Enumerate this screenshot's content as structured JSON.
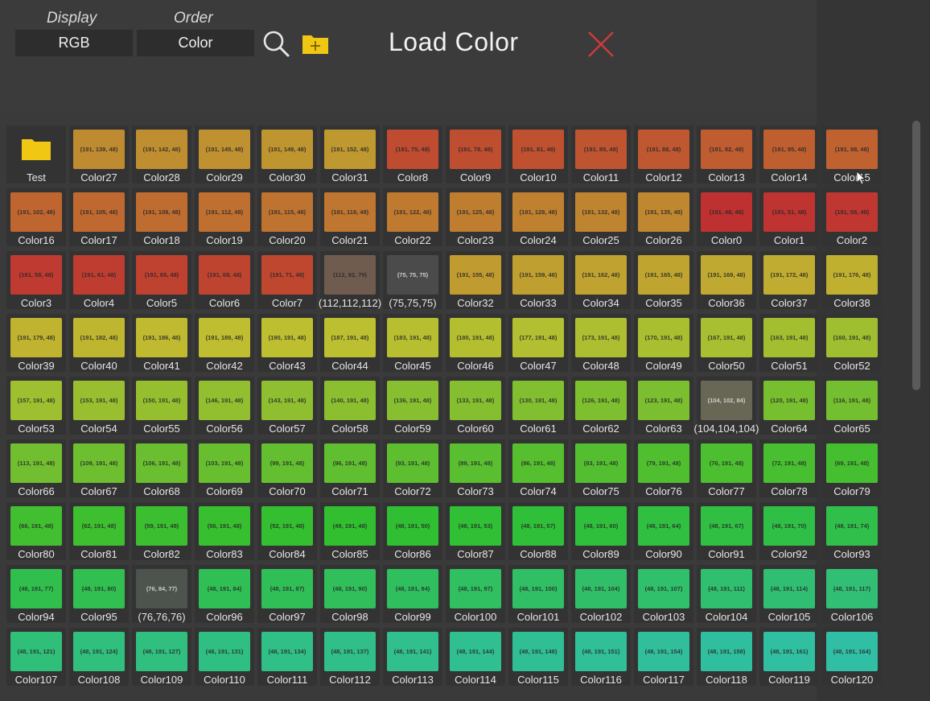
{
  "toolbar": {
    "display_label": "Display",
    "display_value": "RGB",
    "order_label": "Order",
    "order_value": "Color",
    "title": "Load Color",
    "search_icon": "search-icon",
    "new_folder_icon": "folder-add-icon",
    "close_icon": "close-icon",
    "accent_folder": "#f0c814",
    "close_color": "#d03a3a"
  },
  "items": [
    {
      "label": "Test",
      "folder": true
    },
    {
      "label": "Color27",
      "rgb": "(191, 139, 48)",
      "color": "#bf8b30"
    },
    {
      "label": "Color28",
      "rgb": "(191, 142, 48)",
      "color": "#bf8e30"
    },
    {
      "label": "Color29",
      "rgb": "(191, 145, 48)",
      "color": "#bf9130"
    },
    {
      "label": "Color30",
      "rgb": "(191, 149, 48)",
      "color": "#bf9530"
    },
    {
      "label": "Color31",
      "rgb": "(191, 152, 48)",
      "color": "#bf9830"
    },
    {
      "label": "Color8",
      "rgb": "(191, 75, 48)",
      "color": "#bf4b30"
    },
    {
      "label": "Color9",
      "rgb": "(191, 78, 48)",
      "color": "#bf4e30"
    },
    {
      "label": "Color10",
      "rgb": "(191, 81, 48)",
      "color": "#bf5130"
    },
    {
      "label": "Color11",
      "rgb": "(191, 85, 48)",
      "color": "#bf5530"
    },
    {
      "label": "Color12",
      "rgb": "(191, 88, 48)",
      "color": "#bf5830"
    },
    {
      "label": "Color13",
      "rgb": "(191, 92, 48)",
      "color": "#bf5c30"
    },
    {
      "label": "Color14",
      "rgb": "(191, 95, 48)",
      "color": "#bf5f30"
    },
    {
      "label": "Color15",
      "rgb": "(191, 98, 48)",
      "color": "#bf6230"
    },
    {
      "label": "Color16",
      "rgb": "(191, 102, 48)",
      "color": "#bf6630"
    },
    {
      "label": "Color17",
      "rgb": "(191, 105, 48)",
      "color": "#bf6930"
    },
    {
      "label": "Color18",
      "rgb": "(191, 108, 48)",
      "color": "#bf6c30"
    },
    {
      "label": "Color19",
      "rgb": "(191, 112, 48)",
      "color": "#bf7030"
    },
    {
      "label": "Color20",
      "rgb": "(191, 115, 48)",
      "color": "#bf7330"
    },
    {
      "label": "Color21",
      "rgb": "(191, 118, 48)",
      "color": "#bf7630"
    },
    {
      "label": "Color22",
      "rgb": "(191, 122, 48)",
      "color": "#bf7a30"
    },
    {
      "label": "Color23",
      "rgb": "(191, 125, 48)",
      "color": "#bf7d30"
    },
    {
      "label": "Color24",
      "rgb": "(191, 128, 48)",
      "color": "#bf8030"
    },
    {
      "label": "Color25",
      "rgb": "(191, 132, 48)",
      "color": "#bf8430"
    },
    {
      "label": "Color26",
      "rgb": "(191, 135, 48)",
      "color": "#bf8730"
    },
    {
      "label": "Color0",
      "rgb": "(191, 48, 48)",
      "color": "#bf3030"
    },
    {
      "label": "Color1",
      "rgb": "(191, 51, 48)",
      "color": "#bf3330"
    },
    {
      "label": "Color2",
      "rgb": "(191, 55, 48)",
      "color": "#bf3730"
    },
    {
      "label": "Color3",
      "rgb": "(191, 58, 48)",
      "color": "#bf3a30"
    },
    {
      "label": "Color4",
      "rgb": "(191, 61, 48)",
      "color": "#bf3d30"
    },
    {
      "label": "Color5",
      "rgb": "(191, 65, 48)",
      "color": "#bf4130"
    },
    {
      "label": "Color6",
      "rgb": "(191, 68, 48)",
      "color": "#bf4430"
    },
    {
      "label": "Color7",
      "rgb": "(191, 71, 48)",
      "color": "#bf4730"
    },
    {
      "label": "(112,112,112)",
      "rgb": "(112, 92, 79)",
      "color": "#705c4f"
    },
    {
      "label": "(75,75,75)",
      "rgb": "(75, 75, 75)",
      "color": "#4b4b4b",
      "light_text": true
    },
    {
      "label": "Color32",
      "rgb": "(191, 155, 48)",
      "color": "#bf9b30"
    },
    {
      "label": "Color33",
      "rgb": "(191, 159, 48)",
      "color": "#bf9f30"
    },
    {
      "label": "Color34",
      "rgb": "(191, 162, 48)",
      "color": "#bfa230"
    },
    {
      "label": "Color35",
      "rgb": "(191, 165, 48)",
      "color": "#bfa530"
    },
    {
      "label": "Color36",
      "rgb": "(191, 169, 48)",
      "color": "#bfa930"
    },
    {
      "label": "Color37",
      "rgb": "(191, 172, 48)",
      "color": "#bfac30"
    },
    {
      "label": "Color38",
      "rgb": "(191, 176, 48)",
      "color": "#bfb030"
    },
    {
      "label": "Color39",
      "rgb": "(191, 179, 48)",
      "color": "#bfb330"
    },
    {
      "label": "Color40",
      "rgb": "(191, 182, 48)",
      "color": "#bfb630"
    },
    {
      "label": "Color41",
      "rgb": "(191, 186, 48)",
      "color": "#bfba30"
    },
    {
      "label": "Color42",
      "rgb": "(191, 189, 48)",
      "color": "#bfbd30"
    },
    {
      "label": "Color43",
      "rgb": "(190, 191, 48)",
      "color": "#bebf30"
    },
    {
      "label": "Color44",
      "rgb": "(187, 191, 48)",
      "color": "#bbbf30"
    },
    {
      "label": "Color45",
      "rgb": "(183, 191, 48)",
      "color": "#b7bf30"
    },
    {
      "label": "Color46",
      "rgb": "(180, 191, 48)",
      "color": "#b4bf30"
    },
    {
      "label": "Color47",
      "rgb": "(177, 191, 48)",
      "color": "#b1bf30"
    },
    {
      "label": "Color48",
      "rgb": "(173, 191, 48)",
      "color": "#adbf30"
    },
    {
      "label": "Color49",
      "rgb": "(170, 191, 48)",
      "color": "#aabf30"
    },
    {
      "label": "Color50",
      "rgb": "(167, 191, 48)",
      "color": "#a7bf30"
    },
    {
      "label": "Color51",
      "rgb": "(163, 191, 48)",
      "color": "#a3bf30"
    },
    {
      "label": "Color52",
      "rgb": "(160, 191, 48)",
      "color": "#a0bf30"
    },
    {
      "label": "Color53",
      "rgb": "(157, 191, 48)",
      "color": "#9dbf30"
    },
    {
      "label": "Color54",
      "rgb": "(153, 191, 48)",
      "color": "#99bf30"
    },
    {
      "label": "Color55",
      "rgb": "(150, 191, 48)",
      "color": "#96bf30"
    },
    {
      "label": "Color56",
      "rgb": "(146, 191, 48)",
      "color": "#92bf30"
    },
    {
      "label": "Color57",
      "rgb": "(143, 191, 48)",
      "color": "#8fbf30"
    },
    {
      "label": "Color58",
      "rgb": "(140, 191, 48)",
      "color": "#8cbf30"
    },
    {
      "label": "Color59",
      "rgb": "(136, 191, 48)",
      "color": "#88bf30"
    },
    {
      "label": "Color60",
      "rgb": "(133, 191, 48)",
      "color": "#85bf30"
    },
    {
      "label": "Color61",
      "rgb": "(130, 191, 48)",
      "color": "#82bf30"
    },
    {
      "label": "Color62",
      "rgb": "(126, 191, 48)",
      "color": "#7ebf30"
    },
    {
      "label": "Color63",
      "rgb": "(123, 191, 48)",
      "color": "#7bbf30"
    },
    {
      "label": "(104,104,104)",
      "rgb": "(104, 102, 84)",
      "color": "#686654",
      "light_text": true
    },
    {
      "label": "Color64",
      "rgb": "(120, 191, 48)",
      "color": "#78bf30"
    },
    {
      "label": "Color65",
      "rgb": "(116, 191, 48)",
      "color": "#74bf30"
    },
    {
      "label": "Color66",
      "rgb": "(113, 191, 48)",
      "color": "#71bf30"
    },
    {
      "label": "Color67",
      "rgb": "(109, 191, 48)",
      "color": "#6dbf30"
    },
    {
      "label": "Color68",
      "rgb": "(106, 191, 48)",
      "color": "#6abf30"
    },
    {
      "label": "Color69",
      "rgb": "(103, 191, 48)",
      "color": "#67bf30"
    },
    {
      "label": "Color70",
      "rgb": "(99, 191, 48)",
      "color": "#63bf30"
    },
    {
      "label": "Color71",
      "rgb": "(96, 191, 48)",
      "color": "#60bf30"
    },
    {
      "label": "Color72",
      "rgb": "(93, 191, 48)",
      "color": "#5dbf30"
    },
    {
      "label": "Color73",
      "rgb": "(89, 191, 48)",
      "color": "#59bf30"
    },
    {
      "label": "Color74",
      "rgb": "(86, 191, 48)",
      "color": "#56bf30"
    },
    {
      "label": "Color75",
      "rgb": "(83, 191, 48)",
      "color": "#53bf30"
    },
    {
      "label": "Color76",
      "rgb": "(79, 191, 48)",
      "color": "#4fbf30"
    },
    {
      "label": "Color77",
      "rgb": "(76, 191, 48)",
      "color": "#4cbf30"
    },
    {
      "label": "Color78",
      "rgb": "(72, 191, 48)",
      "color": "#48bf30"
    },
    {
      "label": "Color79",
      "rgb": "(69, 191, 48)",
      "color": "#45bf30"
    },
    {
      "label": "Color80",
      "rgb": "(66, 191, 48)",
      "color": "#42bf30"
    },
    {
      "label": "Color81",
      "rgb": "(62, 191, 48)",
      "color": "#3ebf30"
    },
    {
      "label": "Color82",
      "rgb": "(59, 191, 48)",
      "color": "#3bbf30"
    },
    {
      "label": "Color83",
      "rgb": "(56, 191, 48)",
      "color": "#38bf30"
    },
    {
      "label": "Color84",
      "rgb": "(52, 191, 48)",
      "color": "#34bf30"
    },
    {
      "label": "Color85",
      "rgb": "(49, 191, 48)",
      "color": "#31bf30"
    },
    {
      "label": "Color86",
      "rgb": "(48, 191, 50)",
      "color": "#30bf32"
    },
    {
      "label": "Color87",
      "rgb": "(48, 191, 53)",
      "color": "#30bf35"
    },
    {
      "label": "Color88",
      "rgb": "(48, 191, 57)",
      "color": "#30bf39"
    },
    {
      "label": "Color89",
      "rgb": "(48, 191, 60)",
      "color": "#30bf3c"
    },
    {
      "label": "Color90",
      "rgb": "(48, 191, 64)",
      "color": "#30bf40"
    },
    {
      "label": "Color91",
      "rgb": "(48, 191, 67)",
      "color": "#30bf43"
    },
    {
      "label": "Color92",
      "rgb": "(48, 191, 70)",
      "color": "#30bf46"
    },
    {
      "label": "Color93",
      "rgb": "(48, 191, 74)",
      "color": "#30bf4a"
    },
    {
      "label": "Color94",
      "rgb": "(48, 191, 77)",
      "color": "#30bf4d"
    },
    {
      "label": "Color95",
      "rgb": "(48, 191, 80)",
      "color": "#30bf50"
    },
    {
      "label": "(76,76,76)",
      "rgb": "(76, 84, 77)",
      "color": "#4c544d",
      "light_text": true
    },
    {
      "label": "Color96",
      "rgb": "(48, 191, 84)",
      "color": "#30bf54"
    },
    {
      "label": "Color97",
      "rgb": "(48, 191, 87)",
      "color": "#30bf57"
    },
    {
      "label": "Color98",
      "rgb": "(48, 191, 90)",
      "color": "#30bf5a"
    },
    {
      "label": "Color99",
      "rgb": "(48, 191, 94)",
      "color": "#30bf5e"
    },
    {
      "label": "Color100",
      "rgb": "(48, 191, 97)",
      "color": "#30bf61"
    },
    {
      "label": "Color101",
      "rgb": "(48, 191, 100)",
      "color": "#30bf64"
    },
    {
      "label": "Color102",
      "rgb": "(48, 191, 104)",
      "color": "#30bf68"
    },
    {
      "label": "Color103",
      "rgb": "(48, 191, 107)",
      "color": "#30bf6b"
    },
    {
      "label": "Color104",
      "rgb": "(48, 191, 111)",
      "color": "#30bf6f"
    },
    {
      "label": "Color105",
      "rgb": "(48, 191, 114)",
      "color": "#30bf72"
    },
    {
      "label": "Color106",
      "rgb": "(48, 191, 117)",
      "color": "#30bf75"
    },
    {
      "label": "Color107",
      "rgb": "(48, 191, 121)",
      "color": "#30bf79"
    },
    {
      "label": "Color108",
      "rgb": "(48, 191, 124)",
      "color": "#30bf7c"
    },
    {
      "label": "Color109",
      "rgb": "(48, 191, 127)",
      "color": "#30bf7f"
    },
    {
      "label": "Color110",
      "rgb": "(48, 191, 131)",
      "color": "#30bf83"
    },
    {
      "label": "Color111",
      "rgb": "(48, 191, 134)",
      "color": "#30bf86"
    },
    {
      "label": "Color112",
      "rgb": "(48, 191, 137)",
      "color": "#30bf89"
    },
    {
      "label": "Color113",
      "rgb": "(48, 191, 141)",
      "color": "#30bf8d"
    },
    {
      "label": "Color114",
      "rgb": "(48, 191, 144)",
      "color": "#30bf90"
    },
    {
      "label": "Color115",
      "rgb": "(48, 191, 148)",
      "color": "#30bf94"
    },
    {
      "label": "Color116",
      "rgb": "(48, 191, 151)",
      "color": "#30bf97"
    },
    {
      "label": "Color117",
      "rgb": "(48, 191, 154)",
      "color": "#30bf9a"
    },
    {
      "label": "Color118",
      "rgb": "(48, 191, 158)",
      "color": "#30bf9e"
    },
    {
      "label": "Color119",
      "rgb": "(48, 191, 161)",
      "color": "#30bfa1"
    },
    {
      "label": "Color120",
      "rgb": "(48, 191, 164)",
      "color": "#30bfa4"
    }
  ]
}
